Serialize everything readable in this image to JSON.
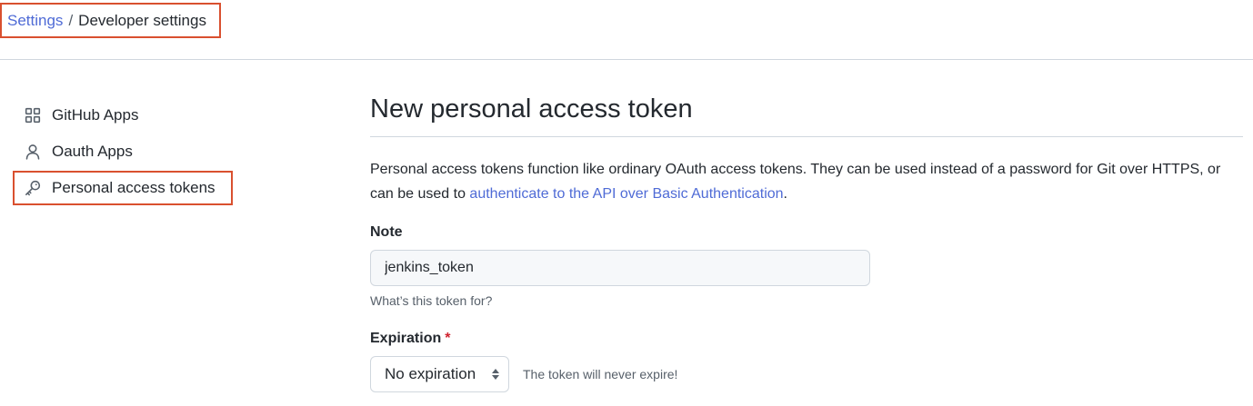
{
  "breadcrumb": {
    "parent": "Settings",
    "separator": "/",
    "current": "Developer settings"
  },
  "sidebar": {
    "items": [
      {
        "label": "GitHub Apps",
        "icon": "apps-grid-icon",
        "active": false
      },
      {
        "label": "Oauth Apps",
        "icon": "person-icon",
        "active": false
      },
      {
        "label": "Personal access tokens",
        "icon": "key-icon",
        "active": true
      }
    ]
  },
  "main": {
    "title": "New personal access token",
    "description_before": "Personal access tokens function like ordinary OAuth access tokens. They can be used instead of a password for Git over HTTPS, or can be used to ",
    "description_link": "authenticate to the API over Basic Authentication",
    "description_after": ".",
    "note": {
      "label": "Note",
      "value": "jenkins_token",
      "hint": "What’s this token for?"
    },
    "expiration": {
      "label": "Expiration",
      "required_mark": "*",
      "selected": "No expiration",
      "note": "The token will never expire!"
    }
  },
  "colors": {
    "link": "#4f6bd6",
    "highlight_border": "#d9502f",
    "required": "#cf222e",
    "input_bg": "#f6f8fa"
  }
}
